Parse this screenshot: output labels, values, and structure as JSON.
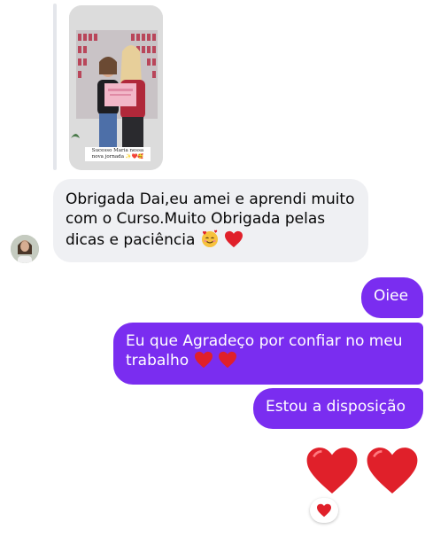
{
  "story": {
    "caption": "Sucesso Maria nessa nova jornada ✨❤️🥰",
    "card_text": "CERTIFICADO"
  },
  "incoming_message": {
    "text": "Obrigada Dai,eu amei e aprendi muito com o Curso.Muito Obrigada pelas dicas e  paciência",
    "trailing_emojis": [
      "smiling-face-with-hearts",
      "red-heart"
    ]
  },
  "outgoing_messages": [
    {
      "text": "Oiee"
    },
    {
      "text": "Eu que Agradeço por confiar no meu trabalho",
      "trailing_emojis": [
        "red-heart",
        "red-heart"
      ]
    },
    {
      "text": "Estou a disposição"
    }
  ],
  "big_emoji_message": {
    "emojis": [
      "red-heart",
      "red-heart"
    ]
  },
  "reaction": {
    "emoji": "red-heart"
  },
  "colors": {
    "outgoing_bubble": "#7a2df0",
    "incoming_bubble": "#eff0f3",
    "heart": "#e0202a"
  }
}
